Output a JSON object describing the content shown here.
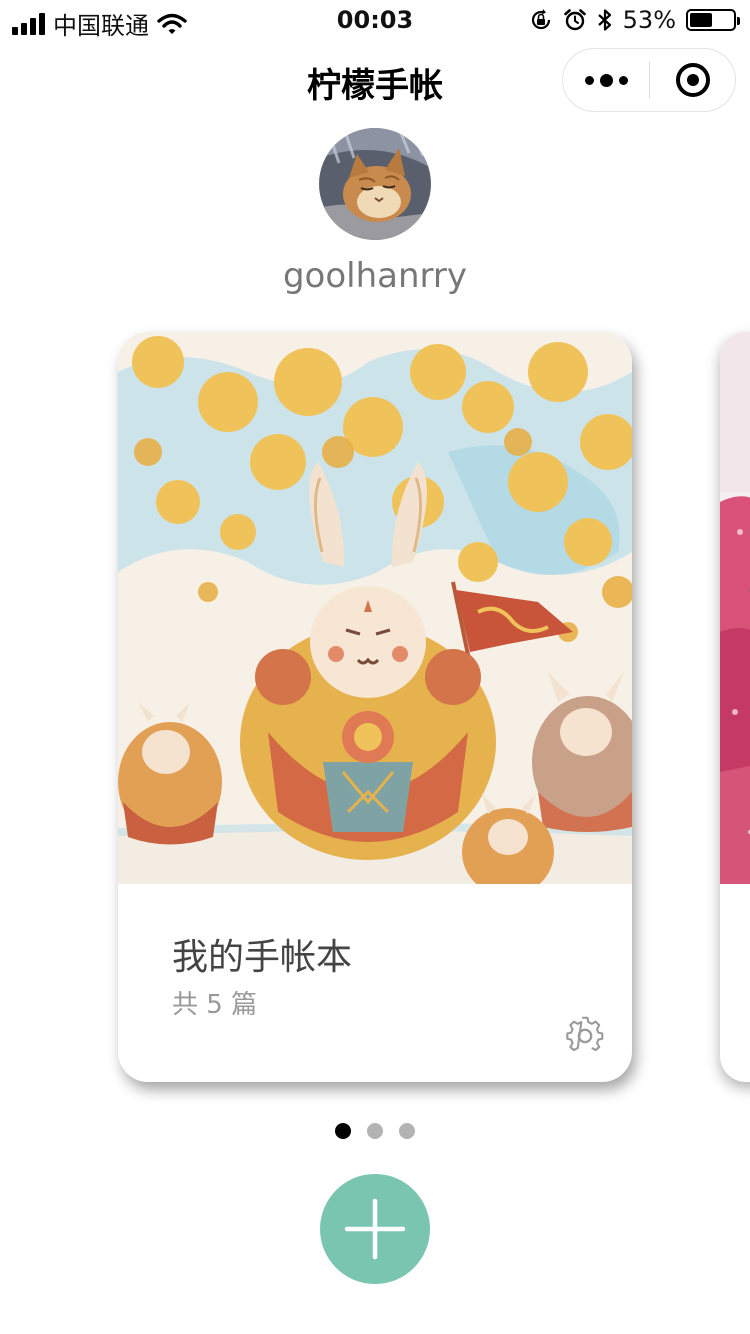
{
  "status_bar": {
    "carrier": "中国联通",
    "time": "00:03",
    "battery_text": "53%",
    "battery_level": 0.53,
    "icons": [
      "signal-icon",
      "wifi-icon",
      "orientation-lock-icon",
      "alarm-icon",
      "bluetooth-icon",
      "battery-icon"
    ]
  },
  "nav": {
    "title": "柠檬手帐",
    "capsule": {
      "more_icon": "more-dots-icon",
      "close_icon": "target-circle-icon"
    }
  },
  "profile": {
    "username": "goolhanrry",
    "avatar": "cat-avatar"
  },
  "notebooks": [
    {
      "title": "我的手帐本",
      "count_text": "共 5 篇",
      "settings_icon": "gear-icon"
    }
  ],
  "pagination": {
    "total": 3,
    "active": 0
  },
  "add_button": {
    "icon": "plus-icon"
  },
  "colors": {
    "accent": "#79c5b0",
    "dot_active": "#000000",
    "dot_inactive": "#b3b3b3",
    "username": "#777777",
    "card_title": "#444444",
    "card_count": "#999999"
  }
}
